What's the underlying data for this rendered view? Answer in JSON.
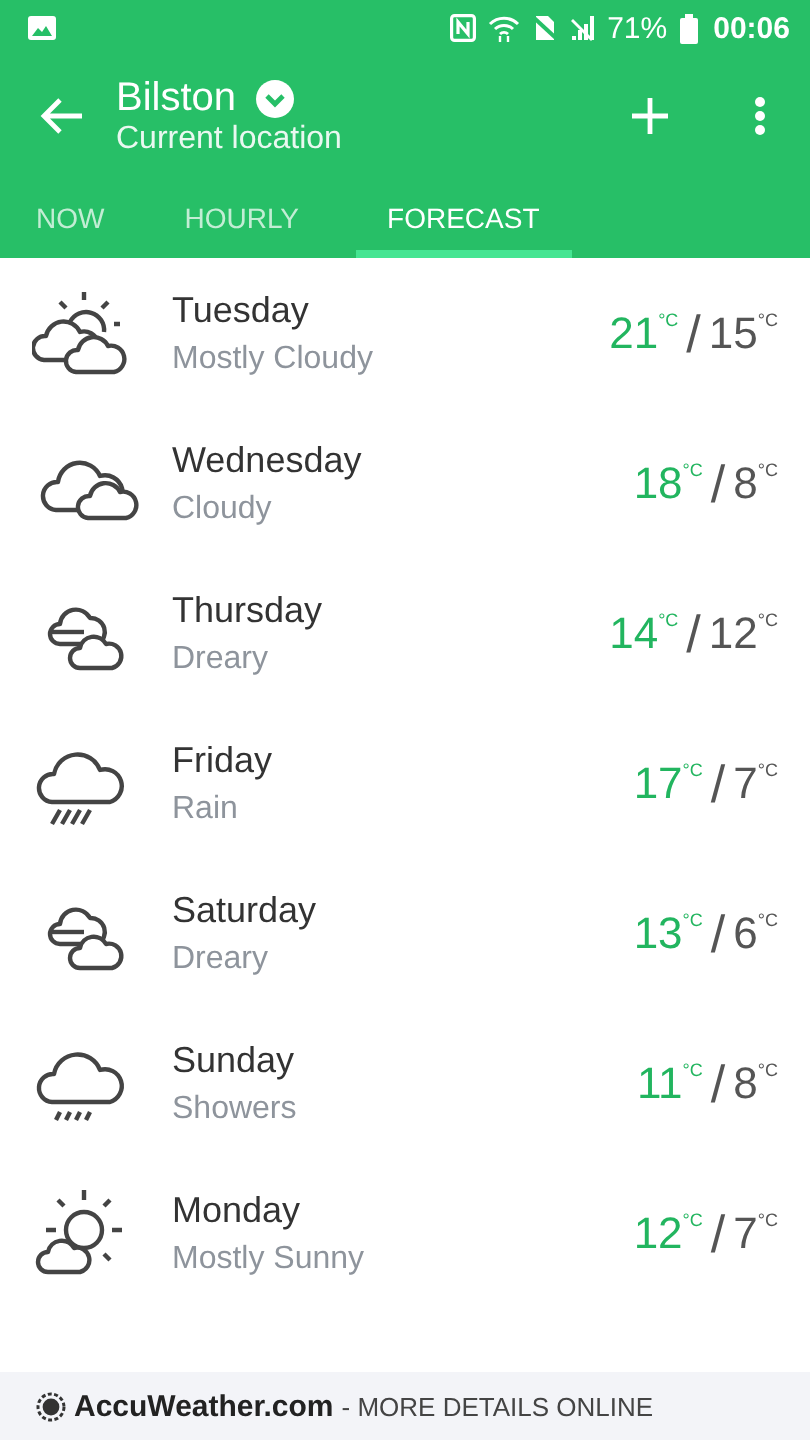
{
  "status_bar": {
    "battery": "71%",
    "time": "00:06"
  },
  "header": {
    "title": "Bilston",
    "subtitle": "Current location"
  },
  "tabs": [
    {
      "label": "NOW",
      "selected": false
    },
    {
      "label": "HOURLY",
      "selected": false
    },
    {
      "label": "FORECAST",
      "selected": true
    }
  ],
  "days": [
    {
      "day": "Tuesday",
      "condition": "Mostly Cloudy",
      "kind": "mostly-cloudy",
      "high": "21",
      "high_unit": "°C",
      "separator": "/",
      "low": "15",
      "low_unit": "°C"
    },
    {
      "day": "Wednesday",
      "condition": "Cloudy",
      "kind": "cloudy",
      "high": "18",
      "high_unit": "°C",
      "separator": "/",
      "low": "8",
      "low_unit": "°C"
    },
    {
      "day": "Thursday",
      "condition": "Dreary",
      "kind": "dreary",
      "high": "14",
      "high_unit": "°C",
      "separator": "/",
      "low": "12",
      "low_unit": "°C"
    },
    {
      "day": "Friday",
      "condition": "Rain",
      "kind": "rain",
      "high": "17",
      "high_unit": "°C",
      "separator": "/",
      "low": "7",
      "low_unit": "°C"
    },
    {
      "day": "Saturday",
      "condition": "Dreary",
      "kind": "dreary",
      "high": "13",
      "high_unit": "°C",
      "separator": "/",
      "low": "6",
      "low_unit": "°C"
    },
    {
      "day": "Sunday",
      "condition": "Showers",
      "kind": "showers",
      "high": "11",
      "high_unit": "°C",
      "separator": "/",
      "low": "8",
      "low_unit": "°C"
    },
    {
      "day": "Monday",
      "condition": "Mostly Sunny",
      "kind": "mostly-sunny",
      "high": "12",
      "high_unit": "°C",
      "separator": "/",
      "low": "7",
      "low_unit": "°C"
    }
  ],
  "footer": {
    "brand": "AccuWeather.com",
    "text": "- MORE DETAILS ONLINE"
  }
}
